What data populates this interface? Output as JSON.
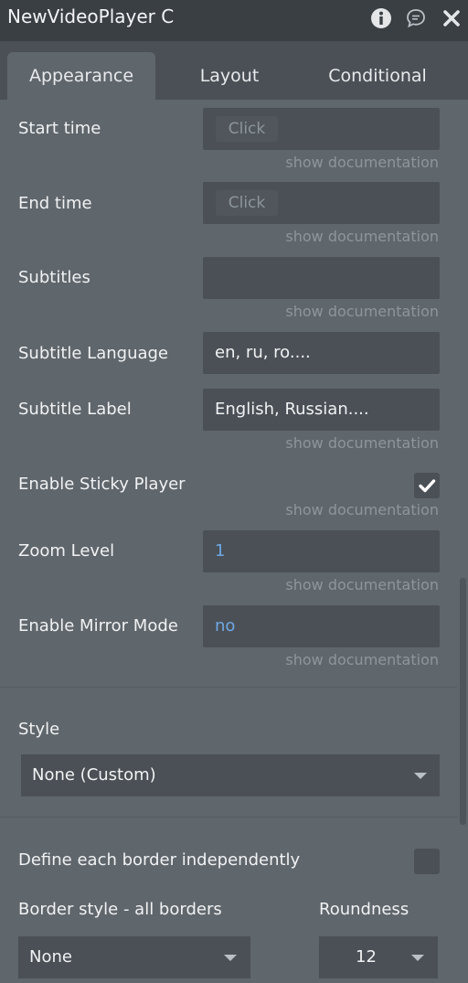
{
  "window": {
    "title": "NewVideoPlayer C"
  },
  "titlebar_icons": [
    "info-icon",
    "chat-icon",
    "close-icon"
  ],
  "tabs": [
    {
      "label": "Appearance",
      "active": true
    },
    {
      "label": "Layout",
      "active": false
    },
    {
      "label": "Conditional",
      "active": false
    }
  ],
  "doc_link": "show documentation",
  "properties": {
    "start_time": {
      "label": "Start time",
      "button": "Click"
    },
    "end_time": {
      "label": "End time",
      "button": "Click"
    },
    "subtitles": {
      "label": "Subtitles",
      "value": ""
    },
    "subtitle_language": {
      "label": "Subtitle Language",
      "placeholder": "en, ru, ro...."
    },
    "subtitle_label": {
      "label": "Subtitle Label",
      "placeholder": "English, Russian...."
    },
    "sticky_player": {
      "label": "Enable Sticky Player",
      "checked": true
    },
    "zoom_level": {
      "label": "Zoom Level",
      "value": "1"
    },
    "mirror_mode": {
      "label": "Enable Mirror Mode",
      "value": "no"
    }
  },
  "style": {
    "label": "Style",
    "value": "None (Custom)"
  },
  "border": {
    "independent_label": "Define each border independently",
    "independent_checked": false,
    "style_label": "Border style - all borders",
    "style_value": "None",
    "roundness_label": "Roundness",
    "roundness_value": "12"
  },
  "colors": {
    "panel_bg": "#5f666c",
    "titlebar_bg": "#3a3f44",
    "field_bg": "#4a5056",
    "muted_text": "#8e969d",
    "dynamic_value": "#6ea8e6"
  }
}
